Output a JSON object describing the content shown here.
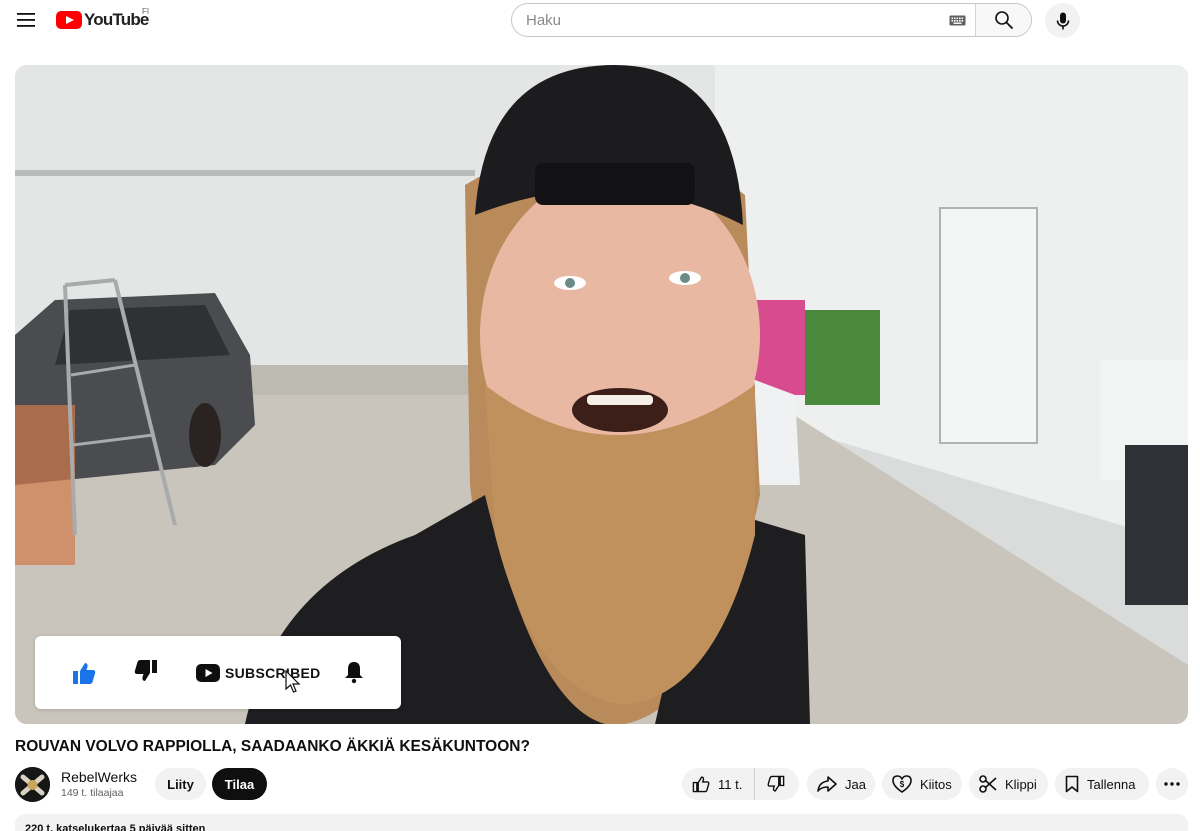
{
  "masthead": {
    "logo_text": "YouTube",
    "country_code": "FI",
    "search_placeholder": "Haku",
    "icons": {
      "menu": "hamburger-icon",
      "keyboard": "keyboard-icon",
      "search": "search-icon",
      "mic": "microphone-icon"
    },
    "brand_color": "#ff0000"
  },
  "player": {
    "overlay": {
      "subscribed_label": "SUBSCRIBED",
      "icons": [
        "thumbs-up-icon",
        "thumbs-down-icon",
        "youtube-icon",
        "bell-icon"
      ],
      "like_color": "#1a73e8"
    }
  },
  "video": {
    "title": "ROUVAN VOLVO RAPPIOLLA, SAADAANKO ÄKKIÄ KESÄKUNTOON?",
    "channel": {
      "name": "RebelWerks",
      "subscribers": "149 t. tilaajaa"
    },
    "join_label": "Liity",
    "subscribe_label": "Tilaa",
    "actions": {
      "like_count": "11 t.",
      "share_label": "Jaa",
      "thanks_label": "Kiitos",
      "clip_label": "Klippi",
      "save_label": "Tallenna"
    },
    "description_summary": "220 t. katselukertaa  5 päivää sitten"
  }
}
